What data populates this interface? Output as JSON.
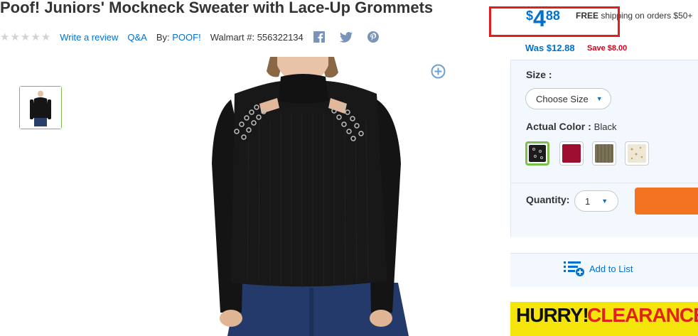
{
  "product": {
    "title": "Poof! Juniors' Mockneck Sweater with Lace-Up Grommets",
    "stars": "★★★★★",
    "write_review": "Write a review",
    "qa": "Q&A",
    "by_label": "By:",
    "brand": "POOF!",
    "walmart_id": "Walmart #: 556322134",
    "social": [
      "facebook-icon",
      "twitter-icon",
      "pinterest-icon"
    ]
  },
  "price": {
    "currency": "$",
    "dollars": "4",
    "cents": "88",
    "free_label": "FREE",
    "shipping_text": " shipping on orders $50+",
    "was": "Was $12.88",
    "save": "Save $8.00"
  },
  "options": {
    "size_label": "Size :",
    "size_placeholder": "Choose Size",
    "color_label": "Actual Color :",
    "color_value": "Black",
    "swatches": [
      {
        "name": "Black",
        "color": "#1c1c1c",
        "selected": true
      },
      {
        "name": "Burgundy",
        "color": "#9c0d2e",
        "selected": false
      },
      {
        "name": "Olive",
        "color": "#7a7358",
        "selected": false
      },
      {
        "name": "Cream Floral",
        "color": "#efe7d6",
        "selected": false
      }
    ],
    "quantity_label": "Quantity:",
    "quantity_value": "1"
  },
  "actions": {
    "add_to_list": "Add to List"
  },
  "banner": {
    "word1": "HURRY!",
    "word2": "CLEARANCE"
  },
  "colors": {
    "accent": "#0071ce",
    "highlight": "#e01e1e",
    "cart": "#f47321",
    "selected": "#7cc04b"
  }
}
